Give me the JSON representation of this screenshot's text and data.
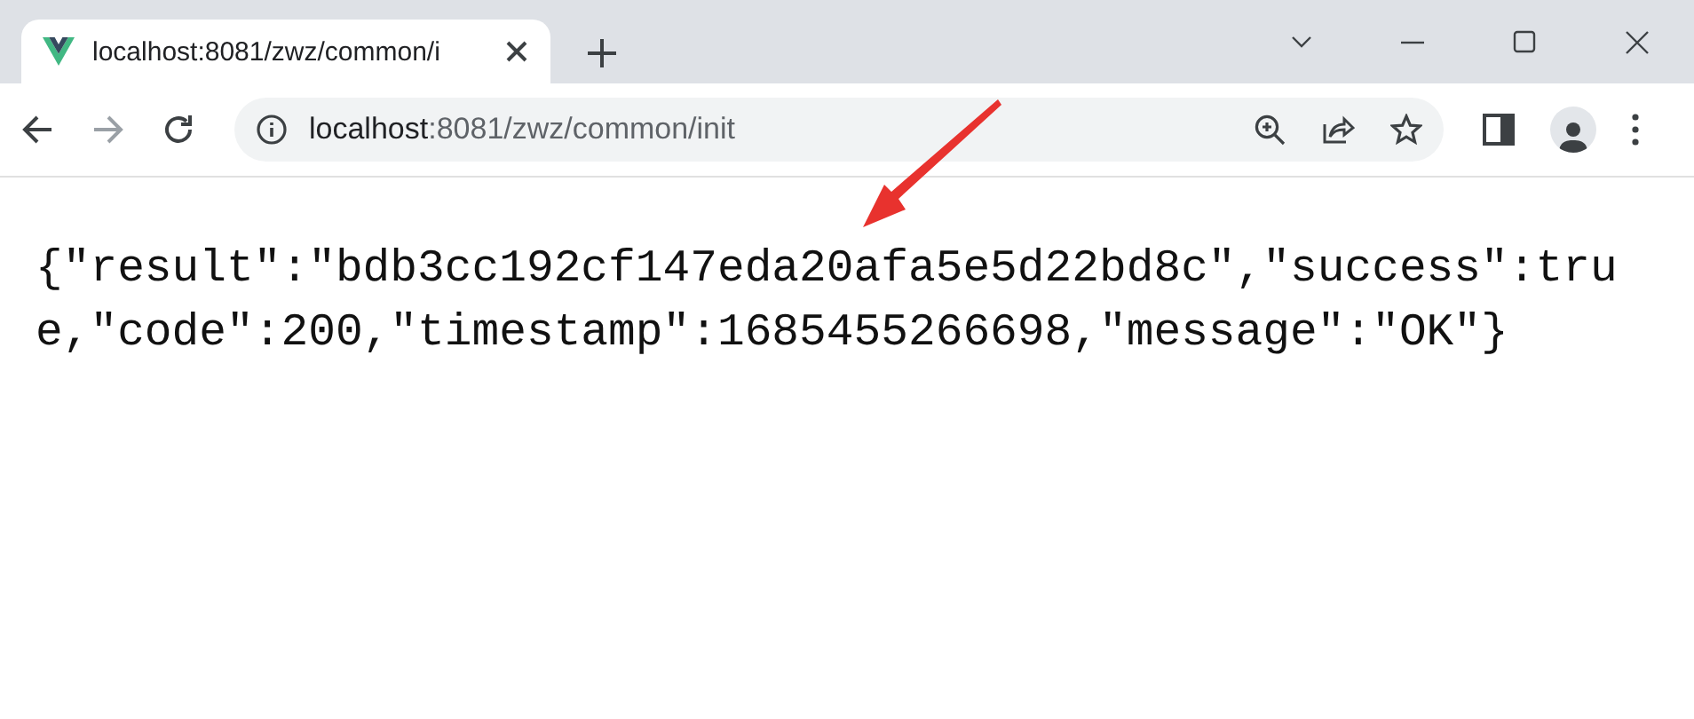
{
  "tabs": [
    {
      "title": "localhost:8081/zwz/common/i",
      "selected": true
    }
  ],
  "address": {
    "host": "localhost",
    "rest": ":8081/zwz/common/init"
  },
  "body_text": "{\"result\":\"bdb3cc192cf147eda20afa5e5d22bd8c\",\"success\":true,\"code\":200,\"timestamp\":1685455266698,\"message\":\"OK\"}"
}
